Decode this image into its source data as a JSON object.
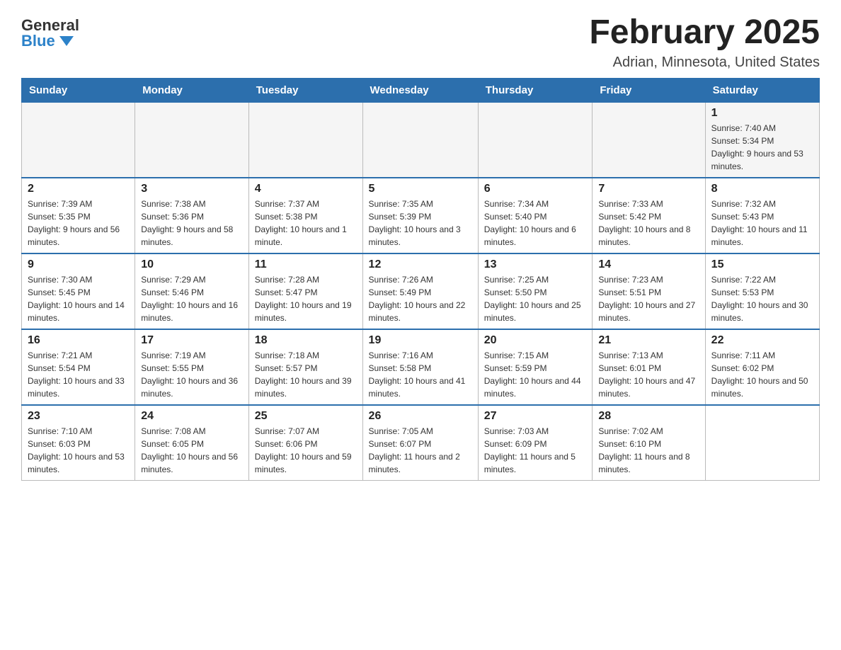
{
  "header": {
    "logo_general": "General",
    "logo_blue": "Blue",
    "month_title": "February 2025",
    "location": "Adrian, Minnesota, United States"
  },
  "weekdays": [
    "Sunday",
    "Monday",
    "Tuesday",
    "Wednesday",
    "Thursday",
    "Friday",
    "Saturday"
  ],
  "weeks": [
    [
      {
        "day": "",
        "sunrise": "",
        "sunset": "",
        "daylight": ""
      },
      {
        "day": "",
        "sunrise": "",
        "sunset": "",
        "daylight": ""
      },
      {
        "day": "",
        "sunrise": "",
        "sunset": "",
        "daylight": ""
      },
      {
        "day": "",
        "sunrise": "",
        "sunset": "",
        "daylight": ""
      },
      {
        "day": "",
        "sunrise": "",
        "sunset": "",
        "daylight": ""
      },
      {
        "day": "",
        "sunrise": "",
        "sunset": "",
        "daylight": ""
      },
      {
        "day": "1",
        "sunrise": "Sunrise: 7:40 AM",
        "sunset": "Sunset: 5:34 PM",
        "daylight": "Daylight: 9 hours and 53 minutes."
      }
    ],
    [
      {
        "day": "2",
        "sunrise": "Sunrise: 7:39 AM",
        "sunset": "Sunset: 5:35 PM",
        "daylight": "Daylight: 9 hours and 56 minutes."
      },
      {
        "day": "3",
        "sunrise": "Sunrise: 7:38 AM",
        "sunset": "Sunset: 5:36 PM",
        "daylight": "Daylight: 9 hours and 58 minutes."
      },
      {
        "day": "4",
        "sunrise": "Sunrise: 7:37 AM",
        "sunset": "Sunset: 5:38 PM",
        "daylight": "Daylight: 10 hours and 1 minute."
      },
      {
        "day": "5",
        "sunrise": "Sunrise: 7:35 AM",
        "sunset": "Sunset: 5:39 PM",
        "daylight": "Daylight: 10 hours and 3 minutes."
      },
      {
        "day": "6",
        "sunrise": "Sunrise: 7:34 AM",
        "sunset": "Sunset: 5:40 PM",
        "daylight": "Daylight: 10 hours and 6 minutes."
      },
      {
        "day": "7",
        "sunrise": "Sunrise: 7:33 AM",
        "sunset": "Sunset: 5:42 PM",
        "daylight": "Daylight: 10 hours and 8 minutes."
      },
      {
        "day": "8",
        "sunrise": "Sunrise: 7:32 AM",
        "sunset": "Sunset: 5:43 PM",
        "daylight": "Daylight: 10 hours and 11 minutes."
      }
    ],
    [
      {
        "day": "9",
        "sunrise": "Sunrise: 7:30 AM",
        "sunset": "Sunset: 5:45 PM",
        "daylight": "Daylight: 10 hours and 14 minutes."
      },
      {
        "day": "10",
        "sunrise": "Sunrise: 7:29 AM",
        "sunset": "Sunset: 5:46 PM",
        "daylight": "Daylight: 10 hours and 16 minutes."
      },
      {
        "day": "11",
        "sunrise": "Sunrise: 7:28 AM",
        "sunset": "Sunset: 5:47 PM",
        "daylight": "Daylight: 10 hours and 19 minutes."
      },
      {
        "day": "12",
        "sunrise": "Sunrise: 7:26 AM",
        "sunset": "Sunset: 5:49 PM",
        "daylight": "Daylight: 10 hours and 22 minutes."
      },
      {
        "day": "13",
        "sunrise": "Sunrise: 7:25 AM",
        "sunset": "Sunset: 5:50 PM",
        "daylight": "Daylight: 10 hours and 25 minutes."
      },
      {
        "day": "14",
        "sunrise": "Sunrise: 7:23 AM",
        "sunset": "Sunset: 5:51 PM",
        "daylight": "Daylight: 10 hours and 27 minutes."
      },
      {
        "day": "15",
        "sunrise": "Sunrise: 7:22 AM",
        "sunset": "Sunset: 5:53 PM",
        "daylight": "Daylight: 10 hours and 30 minutes."
      }
    ],
    [
      {
        "day": "16",
        "sunrise": "Sunrise: 7:21 AM",
        "sunset": "Sunset: 5:54 PM",
        "daylight": "Daylight: 10 hours and 33 minutes."
      },
      {
        "day": "17",
        "sunrise": "Sunrise: 7:19 AM",
        "sunset": "Sunset: 5:55 PM",
        "daylight": "Daylight: 10 hours and 36 minutes."
      },
      {
        "day": "18",
        "sunrise": "Sunrise: 7:18 AM",
        "sunset": "Sunset: 5:57 PM",
        "daylight": "Daylight: 10 hours and 39 minutes."
      },
      {
        "day": "19",
        "sunrise": "Sunrise: 7:16 AM",
        "sunset": "Sunset: 5:58 PM",
        "daylight": "Daylight: 10 hours and 41 minutes."
      },
      {
        "day": "20",
        "sunrise": "Sunrise: 7:15 AM",
        "sunset": "Sunset: 5:59 PM",
        "daylight": "Daylight: 10 hours and 44 minutes."
      },
      {
        "day": "21",
        "sunrise": "Sunrise: 7:13 AM",
        "sunset": "Sunset: 6:01 PM",
        "daylight": "Daylight: 10 hours and 47 minutes."
      },
      {
        "day": "22",
        "sunrise": "Sunrise: 7:11 AM",
        "sunset": "Sunset: 6:02 PM",
        "daylight": "Daylight: 10 hours and 50 minutes."
      }
    ],
    [
      {
        "day": "23",
        "sunrise": "Sunrise: 7:10 AM",
        "sunset": "Sunset: 6:03 PM",
        "daylight": "Daylight: 10 hours and 53 minutes."
      },
      {
        "day": "24",
        "sunrise": "Sunrise: 7:08 AM",
        "sunset": "Sunset: 6:05 PM",
        "daylight": "Daylight: 10 hours and 56 minutes."
      },
      {
        "day": "25",
        "sunrise": "Sunrise: 7:07 AM",
        "sunset": "Sunset: 6:06 PM",
        "daylight": "Daylight: 10 hours and 59 minutes."
      },
      {
        "day": "26",
        "sunrise": "Sunrise: 7:05 AM",
        "sunset": "Sunset: 6:07 PM",
        "daylight": "Daylight: 11 hours and 2 minutes."
      },
      {
        "day": "27",
        "sunrise": "Sunrise: 7:03 AM",
        "sunset": "Sunset: 6:09 PM",
        "daylight": "Daylight: 11 hours and 5 minutes."
      },
      {
        "day": "28",
        "sunrise": "Sunrise: 7:02 AM",
        "sunset": "Sunset: 6:10 PM",
        "daylight": "Daylight: 11 hours and 8 minutes."
      },
      {
        "day": "",
        "sunrise": "",
        "sunset": "",
        "daylight": ""
      }
    ]
  ]
}
